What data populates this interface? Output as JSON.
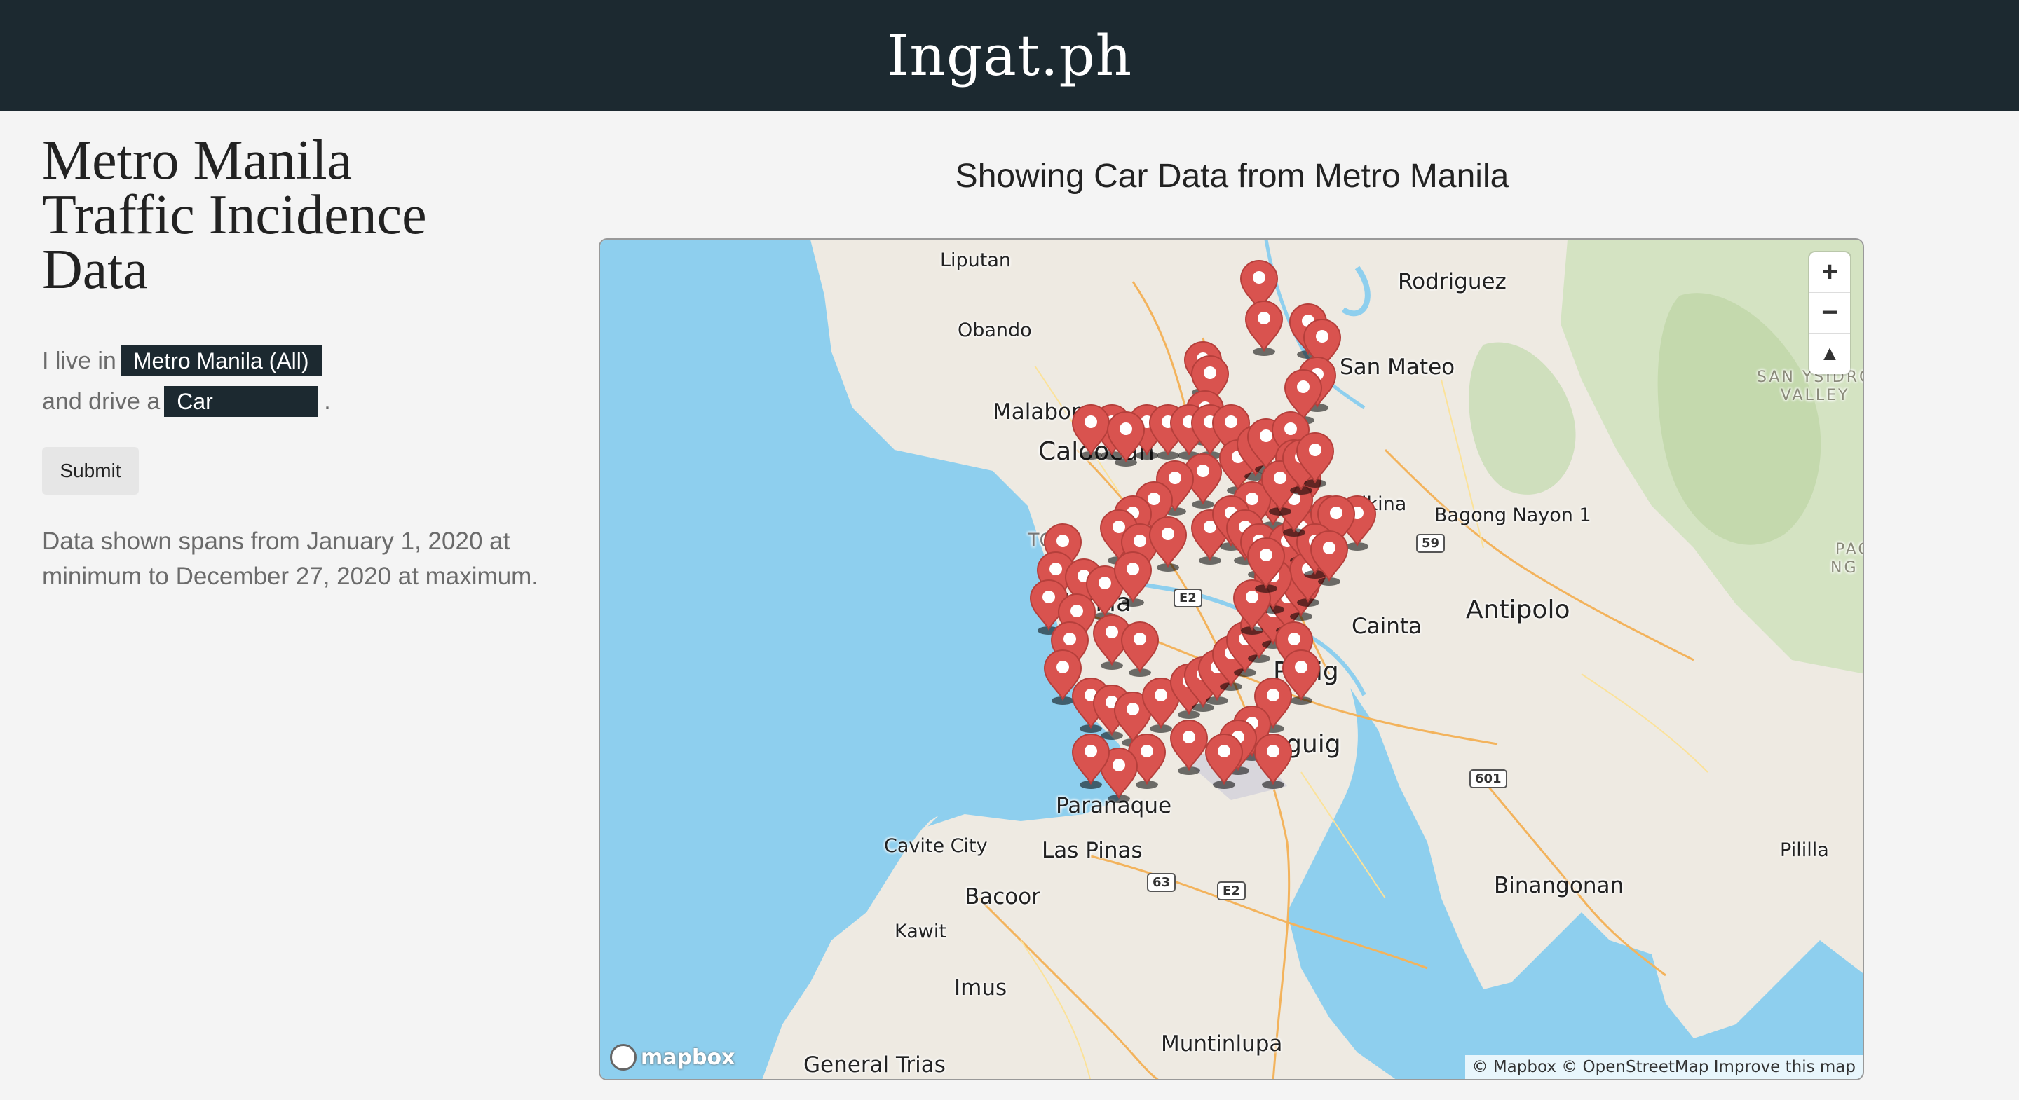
{
  "header": {
    "brand": "Ingat.ph"
  },
  "sidebar": {
    "title_line1": "Metro Manila",
    "title_line2": "Traffic Incidence",
    "title_line3": "Data",
    "live_prefix": "I live in",
    "region_value": "Metro Manila (All)",
    "drive_prefix": "and drive a",
    "vehicle_value": "Car",
    "drive_suffix": ".",
    "submit_label": "Submit",
    "span_note": "Data shown spans from January 1, 2020 at minimum to December 27, 2020 at maximum."
  },
  "map": {
    "title": "Showing Car Data from Metro Manila",
    "zoom_in": "+",
    "zoom_out": "−",
    "compass": "▲",
    "attribution": "© Mapbox © OpenStreetMap Improve this map",
    "logo": "mapbox",
    "labels": {
      "liputan": "Liputan",
      "obando": "Obando",
      "malabon": "Malabon",
      "caloocan": "Caloocan",
      "rodriguez": "Rodriguez",
      "san_mateo": "San Mateo",
      "bagong_nayon": "Bagong Nayon 1",
      "antipolo": "Antipolo",
      "cainta": "Cainta",
      "pasig": "Pasig",
      "taguig": "Taguig",
      "paranaque": "Paranaque",
      "cavite_city": "Cavite City",
      "las_pinas": "Las Pinas",
      "bacoor": "Bacoor",
      "kawit": "Kawit",
      "imus": "Imus",
      "muntinlupa": "Muntinlupa",
      "general_trias": "General Trias",
      "binangonan": "Binangonan",
      "pililla": "Pililla",
      "san_ysidro": "SAN YSIDRO",
      "valley": "VALLEY",
      "pag": "PAG",
      "ng": "NG E",
      "marikina": "Marikina",
      "manila": "Manila",
      "to": "TO"
    },
    "shields": {
      "e2a": "E2",
      "e2b": "E2",
      "r59": "59",
      "r63": "63",
      "r601": "601"
    },
    "colors": {
      "water": "#8ecfee",
      "land": "#eeeae2",
      "pin": "#d9534f",
      "header": "#1c2930"
    }
  }
}
